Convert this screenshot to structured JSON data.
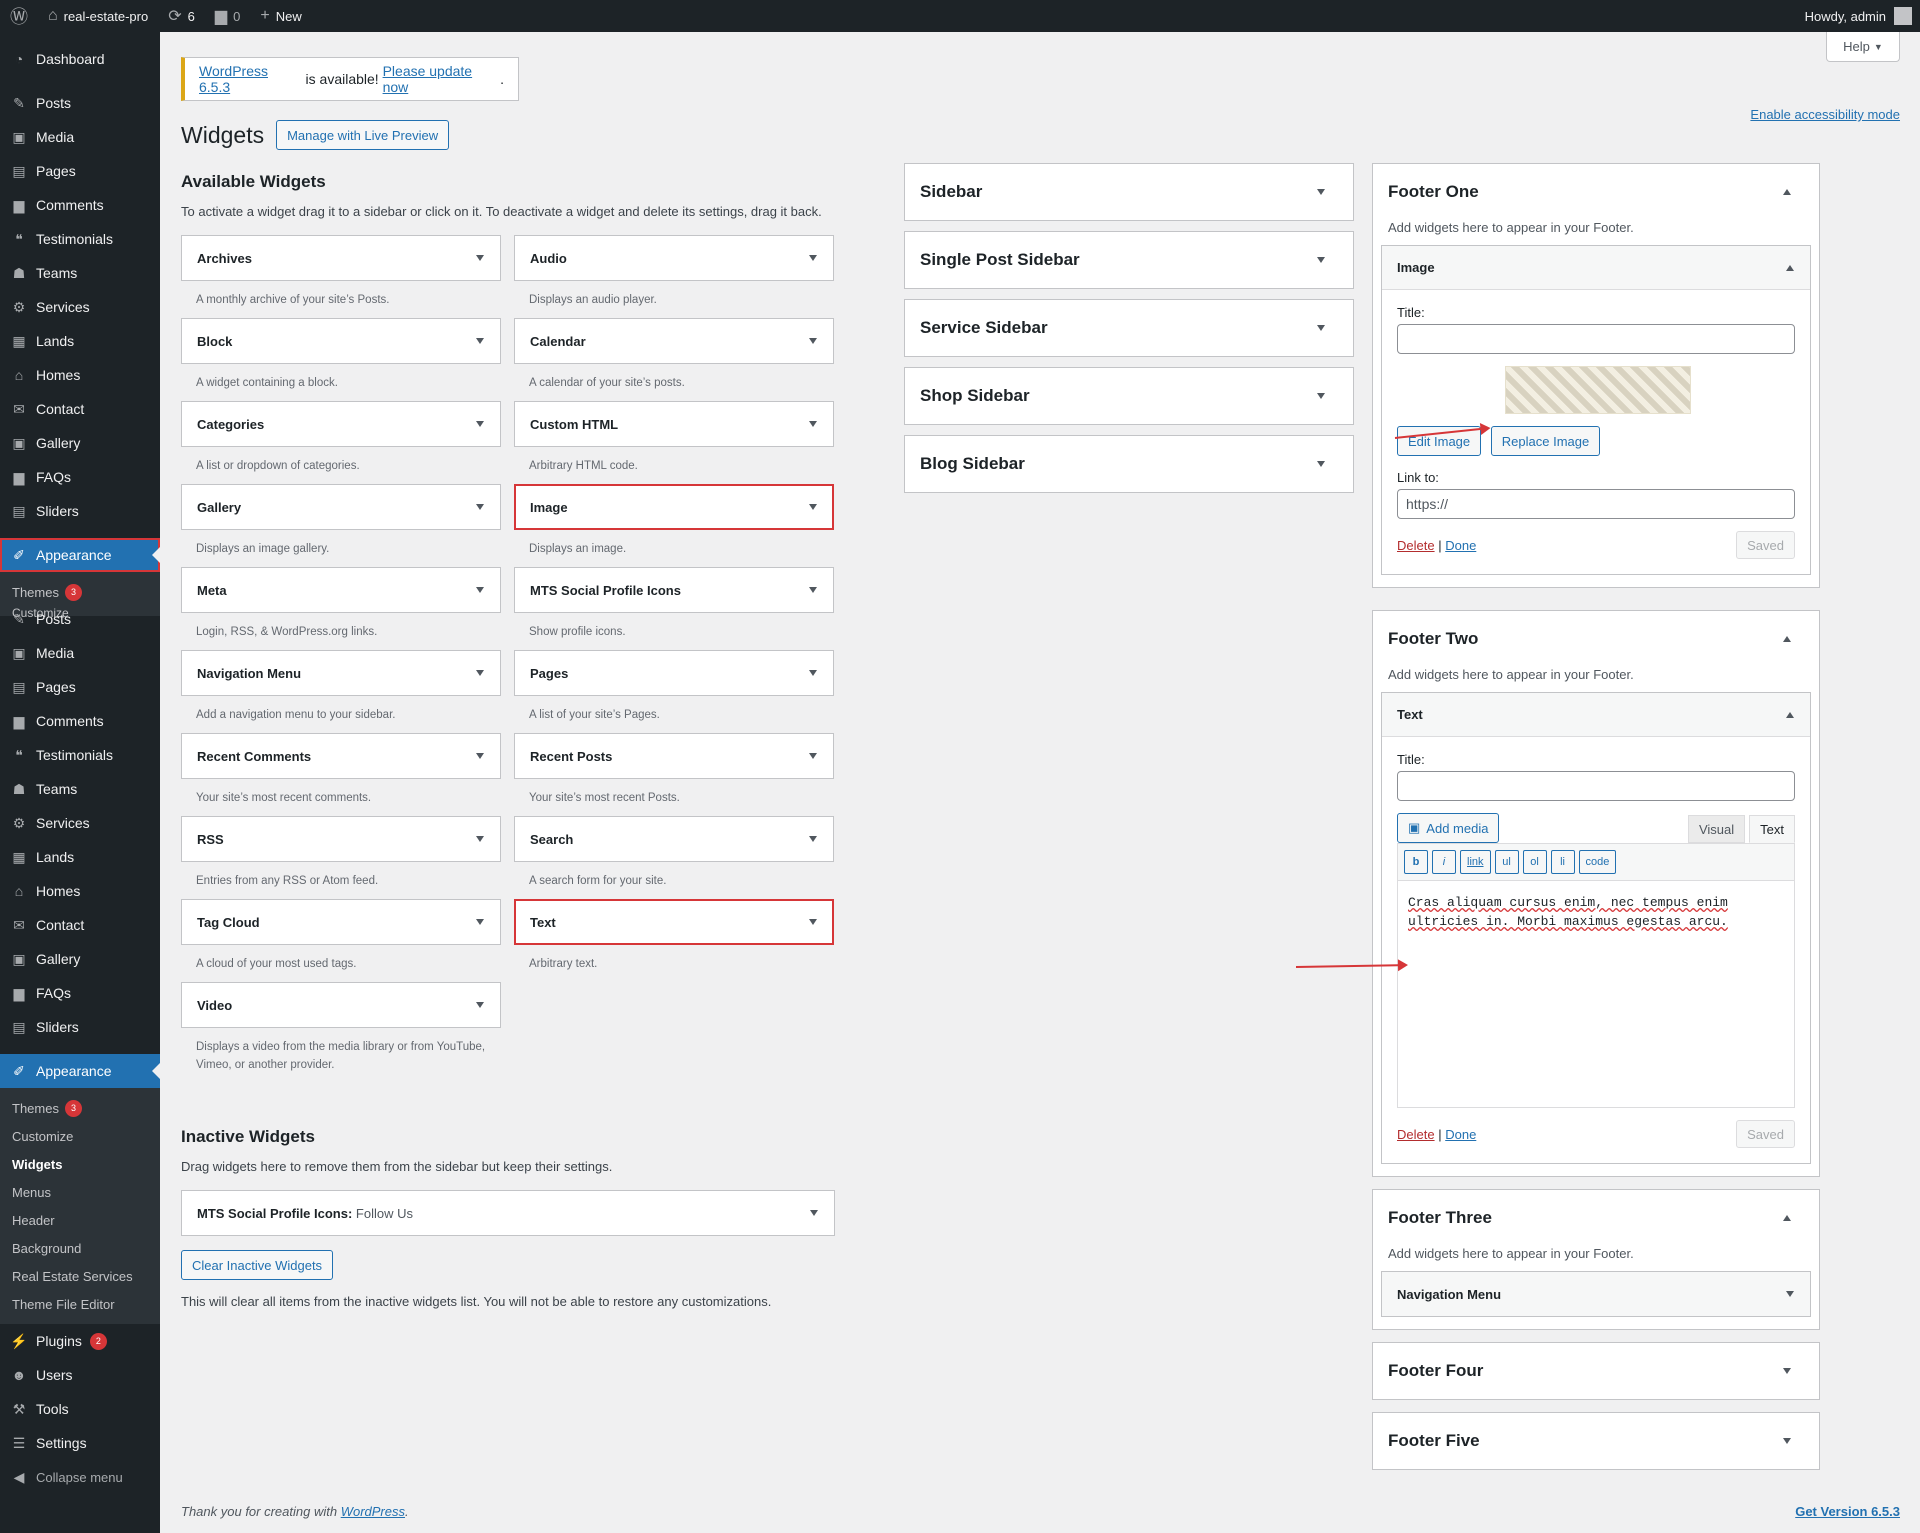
{
  "topbar": {
    "site_name": "real-estate-pro",
    "updates_count": "6",
    "comments_count": "0",
    "new_label": "New",
    "howdy": "Howdy, admin"
  },
  "sidebar": {
    "dashboard": "Dashboard",
    "items_a": [
      "Posts",
      "Media",
      "Pages",
      "Comments",
      "Testimonials",
      "Teams",
      "Services",
      "Lands",
      "Homes",
      "Contact",
      "Gallery",
      "FAQs",
      "Sliders"
    ],
    "appearance": "Appearance",
    "sub_partial": {
      "themes": "Themes",
      "themes_badge": "3",
      "customize": "Customize"
    },
    "items_b": [
      "Posts",
      "Media",
      "Pages",
      "Comments",
      "Testimonials",
      "Teams",
      "Services",
      "Lands",
      "Homes",
      "Contact",
      "Gallery",
      "FAQs",
      "Sliders"
    ],
    "submenu": {
      "themes": "Themes",
      "themes_badge": "3",
      "customize": "Customize",
      "widgets": "Widgets",
      "menus": "Menus",
      "header": "Header",
      "background": "Background",
      "real_estate_services": "Real Estate Services",
      "theme_file_editor": "Theme File Editor"
    },
    "plugins": "Plugins",
    "plugins_badge": "2",
    "users": "Users",
    "tools": "Tools",
    "settings": "Settings",
    "collapse": "Collapse menu"
  },
  "notice": {
    "link1": "WordPress 6.5.3",
    "middle": " is available! ",
    "link2": "Please update now",
    "end": "."
  },
  "help": "Help",
  "page": {
    "title": "Widgets",
    "live_preview": "Manage with Live Preview",
    "accessibility": "Enable accessibility mode"
  },
  "available": {
    "heading": "Available Widgets",
    "desc": "To activate a widget drag it to a sidebar or click on it. To deactivate a widget and delete its settings, drag it back.",
    "widgets": [
      {
        "name": "Archives",
        "desc": "A monthly archive of your site’s Posts."
      },
      {
        "name": "Audio",
        "desc": "Displays an audio player."
      },
      {
        "name": "Block",
        "desc": "A widget containing a block."
      },
      {
        "name": "Calendar",
        "desc": "A calendar of your site’s posts."
      },
      {
        "name": "Categories",
        "desc": "A list or dropdown of categories."
      },
      {
        "name": "Custom HTML",
        "desc": "Arbitrary HTML code."
      },
      {
        "name": "Gallery",
        "desc": "Displays an image gallery."
      },
      {
        "name": "Image",
        "desc": "Displays an image."
      },
      {
        "name": "Meta",
        "desc": "Login, RSS, & WordPress.org links."
      },
      {
        "name": "MTS Social Profile Icons",
        "desc": "Show profile icons."
      },
      {
        "name": "Navigation Menu",
        "desc": "Add a navigation menu to your sidebar."
      },
      {
        "name": "Pages",
        "desc": "A list of your site’s Pages."
      },
      {
        "name": "Recent Comments",
        "desc": "Your site’s most recent comments."
      },
      {
        "name": "Recent Posts",
        "desc": "Your site’s most recent Posts."
      },
      {
        "name": "RSS",
        "desc": "Entries from any RSS or Atom feed."
      },
      {
        "name": "Search",
        "desc": "A search form for your site."
      },
      {
        "name": "Tag Cloud",
        "desc": "A cloud of your most used tags."
      },
      {
        "name": "Text",
        "desc": "Arbitrary text."
      },
      {
        "name": "Video",
        "desc": "Displays a video from the media library or from YouTube, Vimeo, or another provider."
      }
    ]
  },
  "inactive": {
    "heading": "Inactive Widgets",
    "desc": "Drag widgets here to remove them from the sidebar but keep their settings.",
    "widget_name": "MTS Social Profile Icons:",
    "widget_title": " Follow Us",
    "clear_button": "Clear Inactive Widgets",
    "note": "This will clear all items from the inactive widgets list. You will not be able to restore any customizations."
  },
  "areas_mid": [
    "Sidebar",
    "Single Post Sidebar",
    "Service Sidebar",
    "Shop Sidebar",
    "Blog Sidebar"
  ],
  "footer_one": {
    "title": "Footer One",
    "desc": "Add widgets here to appear in your Footer.",
    "widget": "Image",
    "title_label": "Title:",
    "edit_image": "Edit Image",
    "replace_image": "Replace Image",
    "link_label": "Link to:",
    "link_placeholder": "https://",
    "delete": "Delete",
    "sep": "|",
    "done": "Done",
    "saved": "Saved"
  },
  "footer_two": {
    "title": "Footer Two",
    "desc": "Add widgets here to appear in your Footer.",
    "widget": "Text",
    "title_label": "Title:",
    "add_media": "Add media",
    "tab_visual": "Visual",
    "tab_text": "Text",
    "quicktags": [
      "b",
      "i",
      "link",
      "ul",
      "ol",
      "li",
      "code"
    ],
    "content": "Cras aliquam cursus enim, nec tempus enim ultricies in. Morbi maximus egestas arcu.",
    "delete": "Delete",
    "sep": "|",
    "done": "Done",
    "saved": "Saved"
  },
  "footer_three": {
    "title": "Footer Three",
    "desc": "Add widgets here to appear in your Footer.",
    "widget": "Navigation Menu"
  },
  "footer_four": {
    "title": "Footer Four"
  },
  "footer_five": {
    "title": "Footer Five"
  },
  "footer": {
    "thanks_prefix": "Thank you for creating with ",
    "thanks_link": "WordPress",
    "thanks_suffix": ".",
    "version": "Get Version 6.5.3"
  },
  "colors": {
    "accent": "#2271b1",
    "admin_bar": "#1d2327",
    "highlight": "#d63638",
    "notice": "#dba617"
  }
}
